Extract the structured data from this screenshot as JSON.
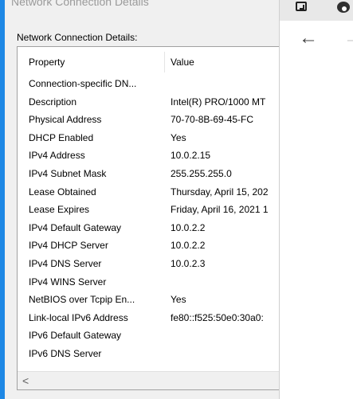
{
  "dialog": {
    "title": "Network Connection Details",
    "section_label": "Network Connection Details:",
    "columns": {
      "property": "Property",
      "value": "Value"
    },
    "rows": [
      {
        "property": "Connection-specific DN...",
        "value": ""
      },
      {
        "property": "Description",
        "value": "Intel(R) PRO/1000 MT"
      },
      {
        "property": "Physical Address",
        "value": "70-70-8B-69-45-FC"
      },
      {
        "property": "DHCP Enabled",
        "value": "Yes"
      },
      {
        "property": "IPv4 Address",
        "value": "10.0.2.15"
      },
      {
        "property": "IPv4 Subnet Mask",
        "value": "255.255.255.0"
      },
      {
        "property": "Lease Obtained",
        "value": "Thursday, April 15, 202"
      },
      {
        "property": "Lease Expires",
        "value": "Friday, April 16, 2021 1"
      },
      {
        "property": "IPv4 Default Gateway",
        "value": "10.0.2.2"
      },
      {
        "property": "IPv4 DHCP Server",
        "value": "10.0.2.2"
      },
      {
        "property": "IPv4 DNS Server",
        "value": "10.0.2.3"
      },
      {
        "property": "IPv4 WINS Server",
        "value": ""
      },
      {
        "property": "NetBIOS over Tcpip En...",
        "value": "Yes"
      },
      {
        "property": "Link-local IPv6 Address",
        "value": "fe80::f525:50e0:30a0:"
      },
      {
        "property": "IPv6 Default Gateway",
        "value": ""
      },
      {
        "property": "IPv6 DNS Server",
        "value": ""
      }
    ],
    "scroll_left_glyph": "<"
  },
  "browser": {
    "back_glyph": "←",
    "forward_glyph": "→"
  },
  "icons": [
    "window-edge-icon",
    "tab-profile-icon",
    "back-arrow-icon",
    "forward-arrow-icon",
    "scroll-left-icon"
  ],
  "colors": {
    "accent": "#1e88e5",
    "dialog_bg": "#f0f0f0",
    "list_bg": "#ffffff"
  }
}
